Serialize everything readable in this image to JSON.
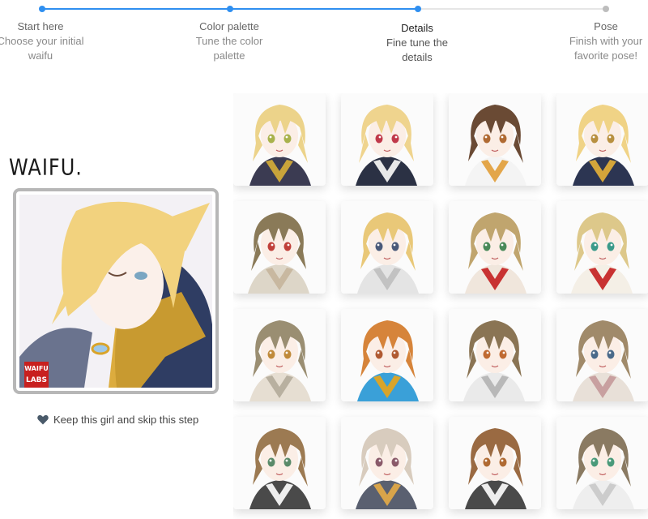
{
  "steps": [
    {
      "title": "Start here",
      "desc": "Choose your initial waifu",
      "status": "done"
    },
    {
      "title": "Color palette",
      "desc": "Tune the color palette",
      "status": "done"
    },
    {
      "title": "Details",
      "desc": "Fine tune the details",
      "status": "current"
    },
    {
      "title": "Pose",
      "desc": "Finish with your favorite pose!",
      "status": "todo"
    }
  ],
  "logo_text": "WAIFU.",
  "badge": {
    "line1": "WAIFU",
    "line2": "LABS"
  },
  "keep_label": "Keep this girl and skip this step",
  "colors": {
    "accent": "#2f8ff0",
    "track_inactive": "#e6e6e6",
    "brand_red": "#c8201f",
    "heart": "#4a5a6a"
  },
  "preview": {
    "hair": "#f2d27e",
    "eye": "#7aa6c2",
    "outfit": "#2f3d63",
    "accent": "#d9a42a"
  },
  "grid": [
    {
      "hair": "#ecd38a",
      "eye": "#a8b24c",
      "outfit": "#3b3b52",
      "accent": "#c9a43a"
    },
    {
      "hair": "#efd48e",
      "eye": "#c0394a",
      "outfit": "#2b3144",
      "accent": "#e8e8e8"
    },
    {
      "hair": "#6a4a34",
      "eye": "#b06a32",
      "outfit": "#f4f4f4",
      "accent": "#e3a64a"
    },
    {
      "hair": "#f0d386",
      "eye": "#b89040",
      "outfit": "#2c3552",
      "accent": "#d4a53a"
    },
    {
      "hair": "#8a7a58",
      "eye": "#c0403a",
      "outfit": "#ddd6c8",
      "accent": "#c8b8a0"
    },
    {
      "hair": "#e9c878",
      "eye": "#4a5a7a",
      "outfit": "#e4e4e4",
      "accent": "#c2c2c2"
    },
    {
      "hair": "#c0a56e",
      "eye": "#4a8a5a",
      "outfit": "#f0e6dc",
      "accent": "#c83232"
    },
    {
      "hair": "#ddc88a",
      "eye": "#3a9a8a",
      "outfit": "#f4efe6",
      "accent": "#c83232"
    },
    {
      "hair": "#9a8e72",
      "eye": "#c08a3a",
      "outfit": "#e6ded2",
      "accent": "#b8b0a0"
    },
    {
      "hair": "#d6843a",
      "eye": "#b05a32",
      "outfit": "#3aa0d8",
      "accent": "#d9a42a"
    },
    {
      "hair": "#8a7454",
      "eye": "#c06a32",
      "outfit": "#eaeaea",
      "accent": "#b8b8b8"
    },
    {
      "hair": "#a08a6a",
      "eye": "#4a6a8a",
      "outfit": "#e8e0d8",
      "accent": "#c8a0a0"
    },
    {
      "hair": "#9c7a52",
      "eye": "#5a8a6a",
      "outfit": "#4a4a4a",
      "accent": "#eeeeee"
    },
    {
      "hair": "#d8ccbe",
      "eye": "#8a5a6a",
      "outfit": "#5a6070",
      "accent": "#d8a44a"
    },
    {
      "hair": "#9a6a42",
      "eye": "#b06a32",
      "outfit": "#4a4a4a",
      "accent": "#eeeeee"
    },
    {
      "hair": "#8a7a62",
      "eye": "#4a9a7a",
      "outfit": "#eeeeee",
      "accent": "#cccccc"
    }
  ]
}
